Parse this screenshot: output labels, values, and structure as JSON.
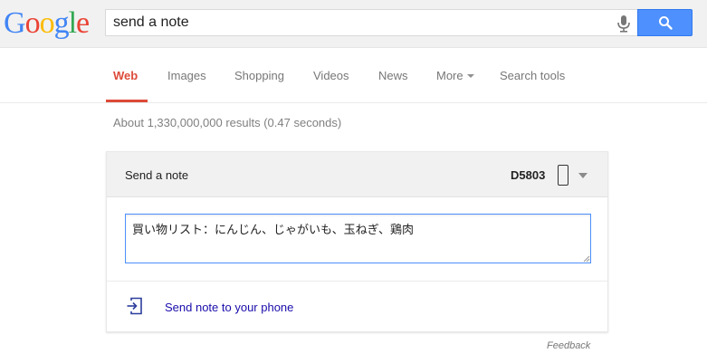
{
  "logo": {
    "letters": [
      "G",
      "o",
      "o",
      "g",
      "l",
      "e"
    ],
    "colors": [
      "#4285f4",
      "#ea4335",
      "#fbbc05",
      "#4285f4",
      "#34a853",
      "#ea4335"
    ]
  },
  "search": {
    "query": "send a note"
  },
  "tabs": [
    {
      "label": "Web",
      "active": true
    },
    {
      "label": "Images"
    },
    {
      "label": "Shopping"
    },
    {
      "label": "Videos"
    },
    {
      "label": "News"
    },
    {
      "label": "More"
    },
    {
      "label": "Search tools"
    }
  ],
  "results_count": "About 1,330,000,000 results (0.47 seconds)",
  "note_card": {
    "title": "Send a note",
    "device": "D5803",
    "note_text": "買い物リスト：にんじん、じゃがいも、玉ねぎ、鶏肉",
    "send_label": "Send note to your phone"
  },
  "feedback": "Feedback",
  "colors": {
    "accent_red": "#dd4b39",
    "search_blue": "#4d90fe",
    "link_blue": "#1a0dab"
  },
  "icons": [
    "microphone-icon",
    "search-icon",
    "phone-icon",
    "chevron-down-icon",
    "send-to-phone-icon"
  ]
}
